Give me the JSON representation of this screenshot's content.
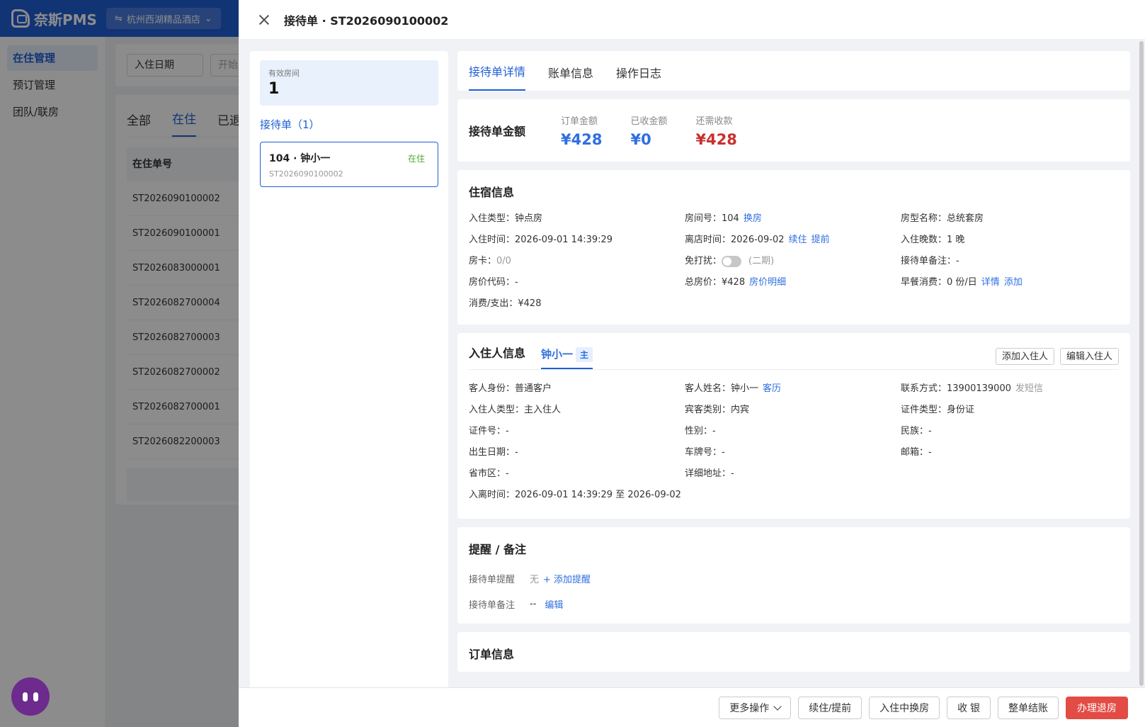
{
  "app": {
    "brand": "奈斯PMS",
    "hotel": "杭州西湖精品酒店"
  },
  "sidebar": {
    "items": [
      {
        "label": "在住管理"
      },
      {
        "label": "预订管理"
      },
      {
        "label": "团队/联房"
      }
    ]
  },
  "bg_filters": {
    "date_type": "入住日期",
    "start_placeholder": "开始"
  },
  "bg_list": {
    "tabs": [
      "全部",
      "在住",
      "已退"
    ],
    "column_header": "在住单号",
    "rows": [
      "ST2026090100002",
      "ST2026090100001",
      "ST2026083000001",
      "ST2026082700004",
      "ST2026082700003",
      "ST2026082700002",
      "ST2026082700001",
      "ST2026082200003"
    ]
  },
  "drawer": {
    "title": "接待单 · ST2026090100002"
  },
  "left": {
    "rooms_label": "有效房间",
    "rooms_count": "1",
    "receipts_heading": "接待单（1）",
    "receipt": {
      "room_guest": "104 · 钟小一",
      "number": "ST2026090100002",
      "status": "在住"
    }
  },
  "tabs": [
    "接待单详情",
    "账单信息",
    "操作日志"
  ],
  "amount": {
    "title": "接待单金额",
    "order_label": "订单金额",
    "order_value": "¥428",
    "received_label": "已收金额",
    "received_value": "¥0",
    "due_label": "还需收款",
    "due_value": "¥428"
  },
  "stay": {
    "title": "住宿信息",
    "checkin_type": "入住类型：钟点房",
    "room_no": "房间号：104",
    "change_room": "换房",
    "room_type": "房型名称：总统套房",
    "checkin_time": "入住时间：2026-09-01 14:39:29",
    "checkout_time": "离店时间：2026-09-02",
    "extend": "续住",
    "advance": "提前",
    "nights": "入住晚数：1 晚",
    "room_card": "房卡：",
    "room_card_value": "0/0",
    "dnd_label": "免打扰：",
    "dnd_note": "(二期)",
    "receipt_note": "接待单备注：-",
    "rate_code": "房价代码：-",
    "total_rate": "总房价：¥428",
    "rate_detail": "房价明细",
    "breakfast": "早餐消费：0 份/日",
    "breakfast_detail": "详情",
    "breakfast_add": "添加",
    "consumption": "消费/支出：¥428"
  },
  "guest": {
    "title": "入住人信息",
    "tab_name": "钟小一",
    "tab_badge": "主",
    "add_btn": "添加入住人",
    "edit_btn": "编辑入住人",
    "identity": "客人身份：普通客户",
    "name": "客人姓名：钟小一",
    "history": "客历",
    "contact": "联系方式：13900139000",
    "sms": "发短信",
    "guest_type": "入住人类型：主入住人",
    "category": "宾客类别：内宾",
    "id_type": "证件类型：身份证",
    "id_no": "证件号：-",
    "gender": "性别：-",
    "ethnicity": "民族：-",
    "birth": "出生日期：-",
    "plate": "车牌号：-",
    "email": "邮箱：-",
    "region": "省市区：-",
    "address": "详细地址：-",
    "stay_period": "入离时间：2026-09-01 14:39:29 至 2026-09-02"
  },
  "notes": {
    "title": "提醒 / 备注",
    "reminder_label": "接待单提醒",
    "reminder_value": "无",
    "add_reminder": "+ 添加提醒",
    "remark_label": "接待单备注",
    "remark_value": "--",
    "edit_remark": "编辑"
  },
  "order": {
    "title": "订单信息"
  },
  "footer": {
    "more": "更多操作",
    "extend": "续住/提前",
    "change_room": "入住中换房",
    "cashier": "收 银",
    "settle": "整单结账",
    "checkout": "办理退房"
  }
}
